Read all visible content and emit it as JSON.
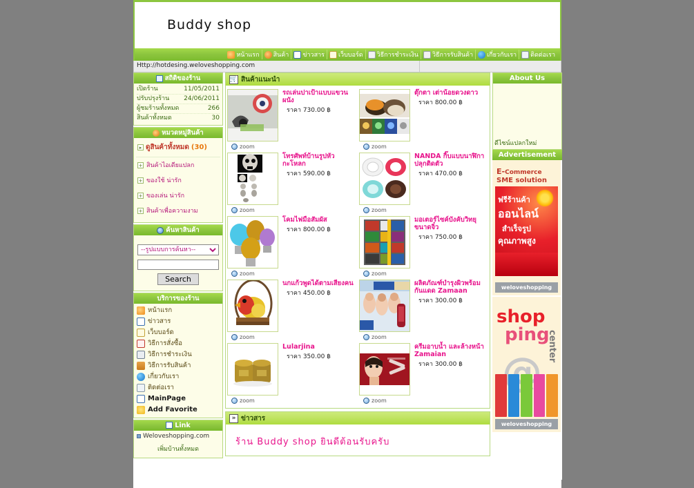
{
  "site": {
    "shop_title": "Buddy shop",
    "url": "Http://hotdesing.weloveshopping.com"
  },
  "topnav": [
    {
      "label": "หน้าแรก",
      "icon": "home-icon"
    },
    {
      "label": "สินค้า",
      "icon": "product-icon"
    },
    {
      "label": "ข่าวสาร",
      "icon": "calendar-icon"
    },
    {
      "label": "เว็บบอร์ด",
      "icon": "webboard-icon"
    },
    {
      "label": "วิธีการชำระเงิน",
      "icon": "document-icon"
    },
    {
      "label": "วิธีการรับสินค้า",
      "icon": "document-icon"
    },
    {
      "label": "เกี่ยวกับเรา",
      "icon": "info-icon"
    },
    {
      "label": "ติดต่อเรา",
      "icon": "mail-icon"
    }
  ],
  "sidebar": {
    "stats": {
      "title": "สถิติของร้าน",
      "rows": [
        {
          "label": "เปิดร้าน",
          "value": "11/05/2011"
        },
        {
          "label": "ปรับปรุงร้าน",
          "value": "24/06/2011"
        },
        {
          "label": "ผู้ชมร้านทั้งหมด",
          "value": "266"
        },
        {
          "label": "สินค้าทั้งหมด",
          "value": "30"
        }
      ]
    },
    "categories": {
      "title": "หมวดหมู่สินค้า",
      "all_label": "ดูสินค้าทั้งหมด",
      "all_count": "(30)",
      "items": [
        "สินค้าไอเดียแปลก",
        "ของใช้ น่ารัก",
        "ของเล่น น่ารัก",
        "สินค้าเพื่อความงาม"
      ]
    },
    "search": {
      "title": "ค้นหาสินค้า",
      "select_value": "--รูปแบบการค้นหา--",
      "input_value": "",
      "button_label": "Search"
    },
    "services": {
      "title": "บริการของร้าน",
      "items": [
        {
          "label": "หน้าแรก",
          "icon": "home-icon",
          "en": false
        },
        {
          "label": "ข่าวสาร",
          "icon": "calendar-icon",
          "en": false
        },
        {
          "label": "เว็บบอร์ด",
          "icon": "webboard-icon",
          "en": false
        },
        {
          "label": "วิธีการสั่งซื้อ",
          "icon": "order-icon",
          "en": false
        },
        {
          "label": "วิธีการชำระเงิน",
          "icon": "calculator-icon",
          "en": false
        },
        {
          "label": "วิธีการรับสินค้า",
          "icon": "box-icon",
          "en": false
        },
        {
          "label": "เกี่ยวกับเรา",
          "icon": "info-icon",
          "en": false
        },
        {
          "label": "ติดต่อเรา",
          "icon": "mail-icon",
          "en": false
        },
        {
          "label": "MainPage",
          "icon": "window-icon",
          "en": true
        },
        {
          "label": "Add Favorite",
          "icon": "star-icon",
          "en": true
        }
      ]
    },
    "links": {
      "title": "Link",
      "items": [
        "Weloveshopping.com"
      ],
      "more_label": "เพิ่มบ้านทั้งหมด"
    }
  },
  "main": {
    "featured_title": "สินค้าแนะนำ",
    "zoom_label": "zoom",
    "products": [
      {
        "name": "รถเล่นปาเป้าแบบแขวน ผนัง",
        "price": "ราคา 730.00 ฿",
        "image": "dartboard-photo"
      },
      {
        "name": "ตุ๊กตา เต่าน้อยดวงดาว",
        "price": "ราคา 800.00 ฿",
        "image": "turtle-lamp-photo"
      },
      {
        "name": "โทรศัพท์บ้านรูปหัวกะโหลก",
        "price": "ราคา 590.00 ฿",
        "image": "skull-phone-photo"
      },
      {
        "name": "NANDA กิ๊บแบบนาฬิกาปลุกติดตัว",
        "price": "ราคา 470.00 ฿",
        "image": "alarm-clock-photo"
      },
      {
        "name": "โคมไฟมือสัมผัส",
        "price": "ราคา 800.00 ฿",
        "image": "touch-lamp-photo"
      },
      {
        "name": "มอเตอร์ไซค์บังคับวิทยุ ขนาดจิ๋ว",
        "price": "ราคา 750.00 ฿",
        "image": "rc-bike-photo"
      },
      {
        "name": "นกแก้วพูดได้ตามเสียงคน",
        "price": "ราคา 450.00 ฿",
        "image": "parrot-toy-photo"
      },
      {
        "name": "ผลิตภัณฑ์บำรุงผิวพร้อมกันแดด Zamaan",
        "price": "ราคา 300.00 ฿",
        "image": "skincare-photo"
      },
      {
        "name": "Lularjina",
        "price": "ราคา 350.00 ฿",
        "image": "gold-jars-photo"
      },
      {
        "name": "ครีมอาบน้ำ และล้างหน้า Zamaian",
        "price": "ราคา 300.00 ฿",
        "image": "facewash-photo"
      }
    ],
    "news_title": "ข่าวสาร",
    "news_text": "ร้าน  Buddy  shop  ยินดีต้อนรับครับ"
  },
  "right": {
    "about_title": "About Us",
    "about_note": "ดีไซน์แปลกใหม่",
    "ad_title": "Advertisement",
    "ads": [
      {
        "line1_bold": "E-",
        "line1_rest": "Commerce",
        "line2": "SME solution",
        "red1": "ฟรีร้านค้า",
        "red2": "ออนไลน์",
        "red3": "สำเร็จรูป",
        "red4": "คุณภาพสูง",
        "footer": "weloveshopping"
      },
      {
        "word1": "shop",
        "word2": "ping",
        "word3": "center",
        "at": "@",
        "footer": "weloveshopping"
      }
    ]
  },
  "colors": {
    "brand_green": "#8dc63f",
    "header_green": "#aedc3f",
    "pink": "#e8148c",
    "panel_cream": "#fdfde8",
    "ad_red": "#e8202a"
  }
}
